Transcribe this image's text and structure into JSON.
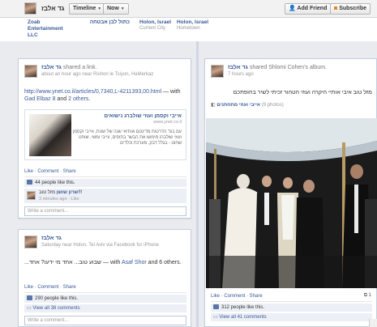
{
  "header": {
    "profile_name": "גד אלבז",
    "timeline_label": "Timeline",
    "now_label": "Now",
    "add_friend_label": "Add Friend",
    "subscribe_label": "Subscribe"
  },
  "about": [
    {
      "title": "Zoab Entertainment LLC",
      "sub": ""
    },
    {
      "title": "כתול לבן אבטחה",
      "sub": ""
    },
    {
      "title": "Holon, Israel",
      "sub": "Current City"
    },
    {
      "title": "Holon, Israel",
      "sub": "Hometown"
    }
  ],
  "post1": {
    "author": "גד אלבז",
    "action": "shared a link.",
    "meta": "about an hour ago near Rishon le Tsiyon, HaMerkaz",
    "url": "http://www.ynet.co.il/articles/0,7340,L-4211393,00.html",
    "with_text": "— with",
    "tag1": "Gad Elbaz 8",
    "and_text": "and",
    "tag2": "2 others.",
    "link_title": "אייבי וקסמן ועוזי שולברג נישואים",
    "link_domain": "www.ynet.co.il",
    "link_desc": "עם בגד הדרטות מדינטם אותיאי שנה של שנות, אייבי וקסמן ועוזי שולברג מימשו את הבשר בתופים, עייבי ומשי, שוחט שחוט - בגלל דבק, מערכת וכלדים",
    "actions": "Like · Comment · Share",
    "likes": "44 people like this.",
    "comment_author": "שרון שושן",
    "comment_text": "מזל טוב!!!",
    "comment_meta": "3 minutes ago · Like",
    "comment_placeholder": "Write a comment..."
  },
  "post2": {
    "author": "גד אלבז",
    "meta": "Saturday near Holon, Tel Aviv via Facebook for iPhone",
    "text": "...שבוע טוב... אחד מי ידעו? אחד",
    "with_text": "— with",
    "tag1": "Asaf Shor",
    "and_text": "and 6 others.",
    "actions": "Like · Comment · Share",
    "likes": "290 people like this.",
    "view_all": "View all 38 comments",
    "comment_placeholder": "Write a comment..."
  },
  "post3": {
    "author": "גד אלבז",
    "action": "shared Shlomi Cohen's album.",
    "meta": "7 hours ago",
    "text": "מזל טוב איבי אותיי היקרה ועוזי הטהור זכיתי לשיר בחופתכם",
    "album_label": "אייבי ועוזי מתחתנים",
    "album_count": "(9 photos)",
    "actions": "Like · Comment · Share",
    "likes": "312 people like this.",
    "view_all": "View all 41 comments",
    "share_count": "1"
  },
  "colors": {
    "link": "#3b5998",
    "spine": "#cfd6e6",
    "background": "#e9ebee"
  }
}
